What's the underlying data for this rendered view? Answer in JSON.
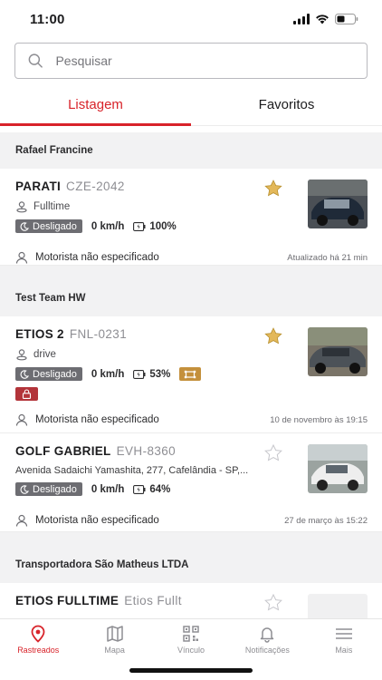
{
  "status_bar": {
    "time": "11:00"
  },
  "search": {
    "placeholder": "Pesquisar"
  },
  "tabs": [
    {
      "label": "Listagem",
      "active": true
    },
    {
      "label": "Favoritos",
      "active": false
    }
  ],
  "groups": [
    {
      "name": "Rafael Francine",
      "vehicles": [
        {
          "name": "PARATI",
          "plate": "CZE-2042",
          "subtitle": "Fulltime",
          "status": "Desligado",
          "speed": "0 km/h",
          "battery": "100%",
          "driver": "Motorista não especificado",
          "updated": "Atualizado há 21 min",
          "favorite": true
        }
      ]
    },
    {
      "name": "Test Team HW",
      "vehicles": [
        {
          "name": "ETIOS 2",
          "plate": "FNL-0231",
          "subtitle": "drive",
          "status": "Desligado",
          "speed": "0 km/h",
          "battery": "53%",
          "driver": "Motorista não especificado",
          "updated": "10 de novembro às 19:15",
          "favorite": true
        },
        {
          "name": "GOLF GABRIEL",
          "plate": "EVH-8360",
          "subtitle": "Avenida Sadaichi Yamashita, 277, Cafelândia - SP,...",
          "status": "Desligado",
          "speed": "0 km/h",
          "battery": "64%",
          "driver": "Motorista não especificado",
          "updated": "27 de março às 15:22",
          "favorite": false
        }
      ]
    },
    {
      "name": "Transportadora São Matheus LTDA",
      "vehicles": [
        {
          "name": "ETIOS FULLTIME",
          "plate": "Etios Fullt",
          "favorite": false
        }
      ]
    }
  ],
  "nav": [
    {
      "label": "Rastreados",
      "icon": "location-pin-icon",
      "active": true
    },
    {
      "label": "Mapa",
      "icon": "map-icon",
      "active": false
    },
    {
      "label": "Vínculo",
      "icon": "qr-code-icon",
      "active": false
    },
    {
      "label": "Notificações",
      "icon": "bell-icon",
      "active": false
    },
    {
      "label": "Mais",
      "icon": "menu-icon",
      "active": false
    }
  ],
  "colors": {
    "accent": "#d8232a",
    "star": "#e3b85a",
    "status_off": "#6d6d72",
    "ignition": "#c4903c",
    "lock": "#b3343a"
  }
}
